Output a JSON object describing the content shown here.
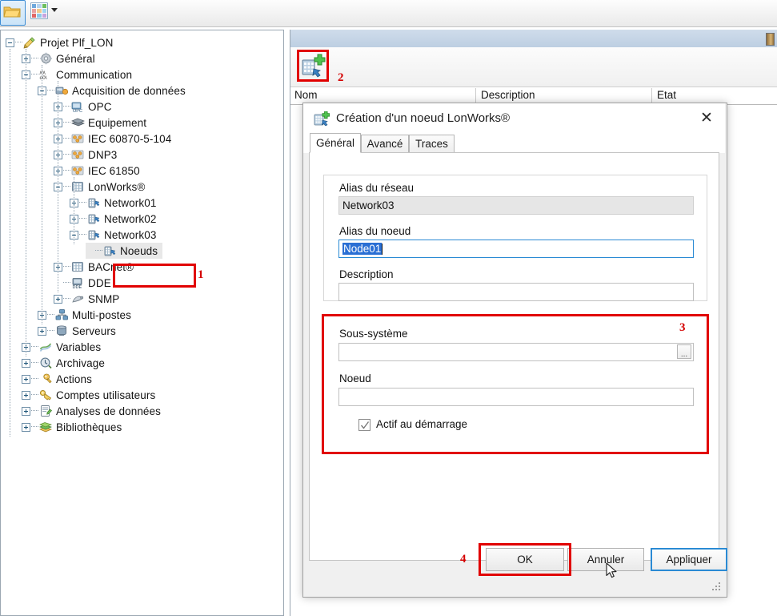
{
  "toolbar": {
    "buttons": [
      {
        "name": "open-folder-button",
        "icon": "folder-icon",
        "selected": true
      },
      {
        "name": "grid-view-button",
        "icon": "grid-icon",
        "selected": false
      },
      {
        "name": "dropdown-caret-button",
        "icon": "chevron-down-icon",
        "selected": false
      }
    ]
  },
  "tree": {
    "nodes": [
      {
        "label": "Projet Plf_LON",
        "depth": 0,
        "expander": "minus",
        "icon": "project-icon"
      },
      {
        "label": "Général",
        "depth": 1,
        "expander": "plus",
        "icon": "gear-icon"
      },
      {
        "label": "Communication",
        "depth": 1,
        "expander": "minus",
        "icon": "communication-icon"
      },
      {
        "label": "Acquisition de données",
        "depth": 2,
        "expander": "minus",
        "icon": "acquisition-icon"
      },
      {
        "label": "OPC",
        "depth": 3,
        "expander": "plus",
        "icon": "opc-icon"
      },
      {
        "label": "Equipement",
        "depth": 3,
        "expander": "plus",
        "icon": "equipment-icon"
      },
      {
        "label": "IEC 60870-5-104",
        "depth": 3,
        "expander": "plus",
        "icon": "protocol-icon"
      },
      {
        "label": "DNP3",
        "depth": 3,
        "expander": "plus",
        "icon": "protocol-icon"
      },
      {
        "label": "IEC 61850",
        "depth": 3,
        "expander": "plus",
        "icon": "protocol-icon"
      },
      {
        "label": "LonWorks®",
        "depth": 3,
        "expander": "minus",
        "icon": "lonworks-icon"
      },
      {
        "label": "Network01",
        "depth": 4,
        "expander": "plus",
        "icon": "network-icon"
      },
      {
        "label": "Network02",
        "depth": 4,
        "expander": "plus",
        "icon": "network-icon"
      },
      {
        "label": "Network03",
        "depth": 4,
        "expander": "minus",
        "icon": "network-icon"
      },
      {
        "label": "Noeuds",
        "depth": 5,
        "expander": "none",
        "icon": "nodes-icon",
        "selected": true
      },
      {
        "label": "BACnet®",
        "depth": 3,
        "expander": "plus",
        "icon": "bacnet-icon"
      },
      {
        "label": "DDE",
        "depth": 3,
        "expander": "none",
        "icon": "dde-icon"
      },
      {
        "label": "SNMP",
        "depth": 3,
        "expander": "plus",
        "icon": "snmp-icon"
      },
      {
        "label": "Multi-postes",
        "depth": 2,
        "expander": "plus",
        "icon": "multiposte-icon"
      },
      {
        "label": "Serveurs",
        "depth": 2,
        "expander": "plus",
        "icon": "server-icon"
      },
      {
        "label": "Variables",
        "depth": 1,
        "expander": "plus",
        "icon": "variables-icon"
      },
      {
        "label": "Archivage",
        "depth": 1,
        "expander": "plus",
        "icon": "archive-icon"
      },
      {
        "label": "Actions",
        "depth": 1,
        "expander": "plus",
        "icon": "actions-icon"
      },
      {
        "label": "Comptes utilisateurs",
        "depth": 1,
        "expander": "plus",
        "icon": "users-icon"
      },
      {
        "label": "Analyses de données",
        "depth": 1,
        "expander": "plus",
        "icon": "analysis-icon"
      },
      {
        "label": "Bibliothèques",
        "depth": 1,
        "expander": "plus",
        "icon": "library-icon"
      }
    ]
  },
  "right_panel": {
    "add_button_label": "",
    "add_button_icon": "add-node-icon",
    "columns": [
      "Nom",
      "Description",
      "Etat"
    ]
  },
  "dialog": {
    "title": "Création d'un noeud LonWorks®",
    "title_icon": "add-node-icon",
    "close_label": "✕",
    "tabs": [
      {
        "label": "Général",
        "active": true
      },
      {
        "label": "Avancé",
        "active": false
      },
      {
        "label": "Traces",
        "active": false
      }
    ],
    "fields": {
      "network_alias_label": "Alias du réseau",
      "network_alias_value": "Network03",
      "node_alias_label": "Alias du noeud",
      "node_alias_value": "Node01",
      "description_label": "Description",
      "description_value": "",
      "subsystem_label": "Sous-système",
      "subsystem_value": "",
      "subsystem_browse_label": "...",
      "node_label": "Noeud",
      "node_value": "",
      "active_startup_label": "Actif au démarrage",
      "active_startup_checked": true
    },
    "buttons": {
      "ok": "OK",
      "cancel": "Annuler",
      "apply": "Appliquer"
    }
  },
  "annotations": [
    {
      "number": "1",
      "target": "tree-node-noeuds"
    },
    {
      "number": "2",
      "target": "add-node-toolbar-button"
    },
    {
      "number": "3",
      "target": "subsystem-node-group"
    },
    {
      "number": "4",
      "target": "ok-button"
    }
  ],
  "colors": {
    "annotation_red": "#e10000",
    "selection_blue": "#2a6fd4",
    "focus_blue": "#2a8ad4",
    "panel_title": "#cfdceb"
  }
}
